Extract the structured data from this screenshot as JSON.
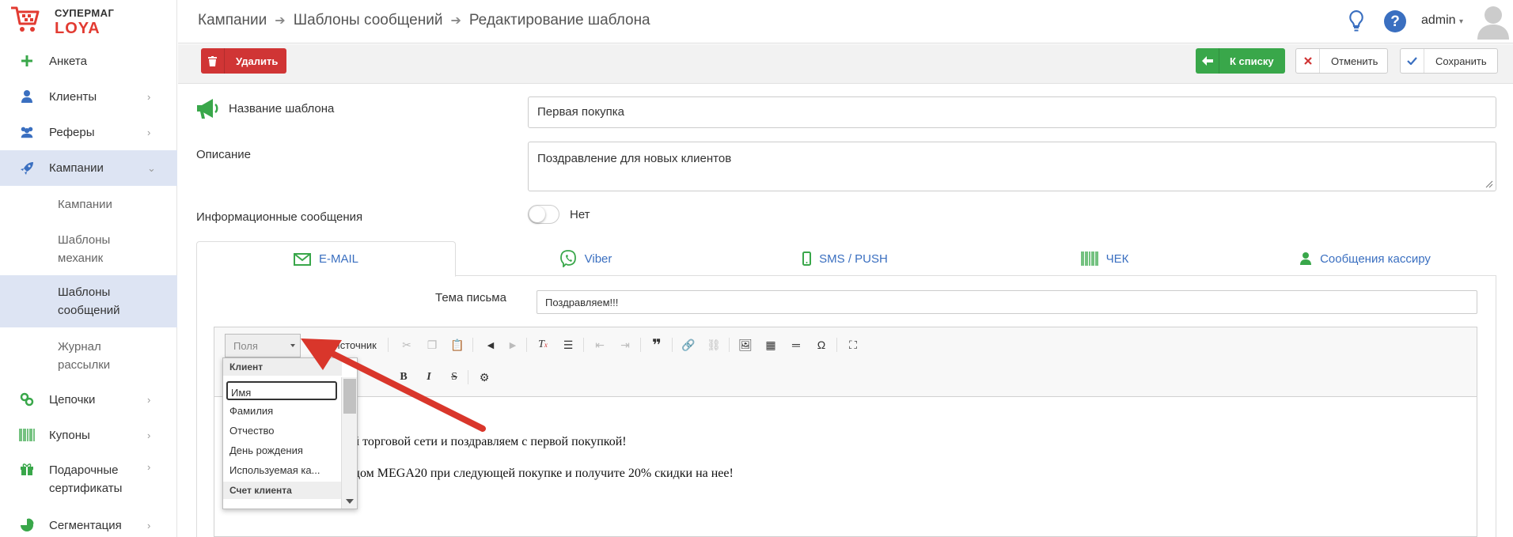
{
  "logo": {
    "line1": "СУПЕРМАГ",
    "line2": "LOYA"
  },
  "sidebar": {
    "items": [
      {
        "label": "Анкета",
        "icon": "plus-icon"
      },
      {
        "label": "Клиенты",
        "icon": "user-icon"
      },
      {
        "label": "Реферы",
        "icon": "users-icon"
      },
      {
        "label": "Кампании",
        "icon": "rocket-icon"
      },
      {
        "label": "Цепочки",
        "icon": "chain-icon"
      },
      {
        "label": "Купоны",
        "icon": "barcode-icon"
      },
      {
        "label": "Подарочные сертификаты",
        "icon": "gift-icon"
      },
      {
        "label": "Сегментация",
        "icon": "pie-chart-icon"
      }
    ],
    "sub": [
      {
        "label": "Кампании"
      },
      {
        "label": "Шаблоны механик"
      },
      {
        "label": "Шаблоны сообщений"
      },
      {
        "label": "Журнал рассылки"
      }
    ]
  },
  "breadcrumbs": [
    "Кампании",
    "Шаблоны сообщений",
    "Редактирование шаблона"
  ],
  "header": {
    "user": "admin"
  },
  "toolbar": {
    "delete": "Удалить",
    "to_list": "К списку",
    "cancel": "Отменить",
    "save": "Сохранить"
  },
  "form": {
    "name_label": "Название шаблона",
    "name_value": "Первая покупка",
    "desc_label": "Описание",
    "desc_value": "Поздравление для новых клиентов",
    "info_label": "Информационные сообщения",
    "info_toggle": "Нет"
  },
  "tabs": [
    {
      "label": "E-MAIL",
      "icon": "envelope-icon"
    },
    {
      "label": "Viber",
      "icon": "viber-icon"
    },
    {
      "label": "SMS / PUSH",
      "icon": "mobile-icon"
    },
    {
      "label": "ЧЕК",
      "icon": "barcode-icon"
    },
    {
      "label": "Сообщения кассиру",
      "icon": "user-icon"
    }
  ],
  "email": {
    "subject_label": "Тема письма",
    "subject_value": "Поздравляем!!!",
    "fields_combo": "Поля",
    "source_button": "Источник",
    "body_line1": "ашей торговой сети и поздравляем с первой покупкой!",
    "body_line2": "о-кодом MEGA20 при следующей покупке и получите 20% скидки на нее!"
  },
  "fields_dropdown": {
    "group1": "Клиент",
    "options": [
      "Имя",
      "Фамилия",
      "Отчество",
      "День рождения",
      "Используемая ка..."
    ],
    "group2": "Счет клиента"
  },
  "colors": {
    "accent": "#3a6fc0",
    "danger": "#d03535",
    "success": "#39a74a",
    "brand_red": "#e23b32",
    "active_bg": "#dde4f3",
    "arrow": "#d9362b"
  }
}
